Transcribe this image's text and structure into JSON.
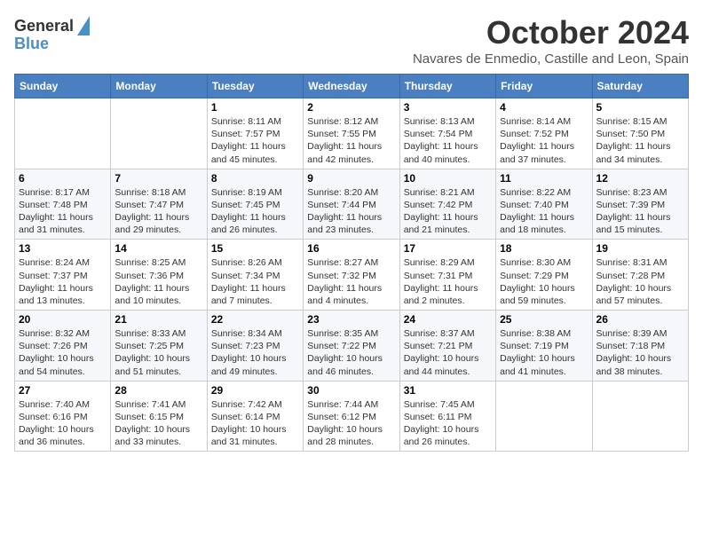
{
  "logo": {
    "line1": "General",
    "line2": "Blue"
  },
  "title": "October 2024",
  "subtitle": "Navares de Enmedio, Castille and Leon, Spain",
  "days_of_week": [
    "Sunday",
    "Monday",
    "Tuesday",
    "Wednesday",
    "Thursday",
    "Friday",
    "Saturday"
  ],
  "weeks": [
    [
      {
        "day": null,
        "info": ""
      },
      {
        "day": null,
        "info": ""
      },
      {
        "day": "1",
        "info": "Sunrise: 8:11 AM\nSunset: 7:57 PM\nDaylight: 11 hours and 45 minutes."
      },
      {
        "day": "2",
        "info": "Sunrise: 8:12 AM\nSunset: 7:55 PM\nDaylight: 11 hours and 42 minutes."
      },
      {
        "day": "3",
        "info": "Sunrise: 8:13 AM\nSunset: 7:54 PM\nDaylight: 11 hours and 40 minutes."
      },
      {
        "day": "4",
        "info": "Sunrise: 8:14 AM\nSunset: 7:52 PM\nDaylight: 11 hours and 37 minutes."
      },
      {
        "day": "5",
        "info": "Sunrise: 8:15 AM\nSunset: 7:50 PM\nDaylight: 11 hours and 34 minutes."
      }
    ],
    [
      {
        "day": "6",
        "info": "Sunrise: 8:17 AM\nSunset: 7:48 PM\nDaylight: 11 hours and 31 minutes."
      },
      {
        "day": "7",
        "info": "Sunrise: 8:18 AM\nSunset: 7:47 PM\nDaylight: 11 hours and 29 minutes."
      },
      {
        "day": "8",
        "info": "Sunrise: 8:19 AM\nSunset: 7:45 PM\nDaylight: 11 hours and 26 minutes."
      },
      {
        "day": "9",
        "info": "Sunrise: 8:20 AM\nSunset: 7:44 PM\nDaylight: 11 hours and 23 minutes."
      },
      {
        "day": "10",
        "info": "Sunrise: 8:21 AM\nSunset: 7:42 PM\nDaylight: 11 hours and 21 minutes."
      },
      {
        "day": "11",
        "info": "Sunrise: 8:22 AM\nSunset: 7:40 PM\nDaylight: 11 hours and 18 minutes."
      },
      {
        "day": "12",
        "info": "Sunrise: 8:23 AM\nSunset: 7:39 PM\nDaylight: 11 hours and 15 minutes."
      }
    ],
    [
      {
        "day": "13",
        "info": "Sunrise: 8:24 AM\nSunset: 7:37 PM\nDaylight: 11 hours and 13 minutes."
      },
      {
        "day": "14",
        "info": "Sunrise: 8:25 AM\nSunset: 7:36 PM\nDaylight: 11 hours and 10 minutes."
      },
      {
        "day": "15",
        "info": "Sunrise: 8:26 AM\nSunset: 7:34 PM\nDaylight: 11 hours and 7 minutes."
      },
      {
        "day": "16",
        "info": "Sunrise: 8:27 AM\nSunset: 7:32 PM\nDaylight: 11 hours and 4 minutes."
      },
      {
        "day": "17",
        "info": "Sunrise: 8:29 AM\nSunset: 7:31 PM\nDaylight: 11 hours and 2 minutes."
      },
      {
        "day": "18",
        "info": "Sunrise: 8:30 AM\nSunset: 7:29 PM\nDaylight: 10 hours and 59 minutes."
      },
      {
        "day": "19",
        "info": "Sunrise: 8:31 AM\nSunset: 7:28 PM\nDaylight: 10 hours and 57 minutes."
      }
    ],
    [
      {
        "day": "20",
        "info": "Sunrise: 8:32 AM\nSunset: 7:26 PM\nDaylight: 10 hours and 54 minutes."
      },
      {
        "day": "21",
        "info": "Sunrise: 8:33 AM\nSunset: 7:25 PM\nDaylight: 10 hours and 51 minutes."
      },
      {
        "day": "22",
        "info": "Sunrise: 8:34 AM\nSunset: 7:23 PM\nDaylight: 10 hours and 49 minutes."
      },
      {
        "day": "23",
        "info": "Sunrise: 8:35 AM\nSunset: 7:22 PM\nDaylight: 10 hours and 46 minutes."
      },
      {
        "day": "24",
        "info": "Sunrise: 8:37 AM\nSunset: 7:21 PM\nDaylight: 10 hours and 44 minutes."
      },
      {
        "day": "25",
        "info": "Sunrise: 8:38 AM\nSunset: 7:19 PM\nDaylight: 10 hours and 41 minutes."
      },
      {
        "day": "26",
        "info": "Sunrise: 8:39 AM\nSunset: 7:18 PM\nDaylight: 10 hours and 38 minutes."
      }
    ],
    [
      {
        "day": "27",
        "info": "Sunrise: 7:40 AM\nSunset: 6:16 PM\nDaylight: 10 hours and 36 minutes."
      },
      {
        "day": "28",
        "info": "Sunrise: 7:41 AM\nSunset: 6:15 PM\nDaylight: 10 hours and 33 minutes."
      },
      {
        "day": "29",
        "info": "Sunrise: 7:42 AM\nSunset: 6:14 PM\nDaylight: 10 hours and 31 minutes."
      },
      {
        "day": "30",
        "info": "Sunrise: 7:44 AM\nSunset: 6:12 PM\nDaylight: 10 hours and 28 minutes."
      },
      {
        "day": "31",
        "info": "Sunrise: 7:45 AM\nSunset: 6:11 PM\nDaylight: 10 hours and 26 minutes."
      },
      {
        "day": null,
        "info": ""
      },
      {
        "day": null,
        "info": ""
      }
    ]
  ]
}
